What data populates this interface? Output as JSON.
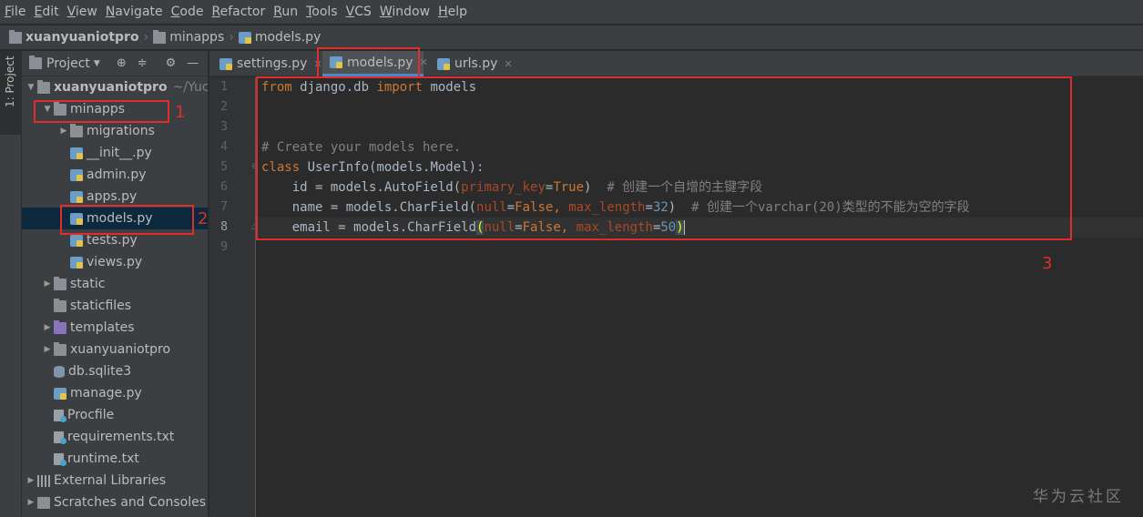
{
  "menu": {
    "items": [
      {
        "mnemonic": "F",
        "rest": "ile"
      },
      {
        "mnemonic": "E",
        "rest": "dit"
      },
      {
        "mnemonic": "V",
        "rest": "iew"
      },
      {
        "mnemonic": "N",
        "rest": "avigate"
      },
      {
        "mnemonic": "C",
        "rest": "ode"
      },
      {
        "mnemonic": "R",
        "rest": "efactor"
      },
      {
        "mnemonic": "R",
        "rest": "un"
      },
      {
        "mnemonic": "T",
        "rest": "ools"
      },
      {
        "mnemonic": "V",
        "rest": "CS"
      },
      {
        "mnemonic": "W",
        "rest": "indow"
      },
      {
        "mnemonic": "H",
        "rest": "elp"
      }
    ]
  },
  "breadcrumb": [
    "xuanyuaniotpro",
    "minapps",
    "models.py"
  ],
  "stripe": {
    "label": "1: Project"
  },
  "project_panel": {
    "title": "Project",
    "tree": [
      {
        "label": "xuanyuaniotpro",
        "path": "~/Yuchu",
        "icon": "folder-icon",
        "level": 0,
        "arrow": "down"
      },
      {
        "label": "minapps",
        "icon": "folder-icon",
        "level": 1,
        "arrow": "down"
      },
      {
        "label": "migrations",
        "icon": "folder-icon",
        "level": 2,
        "arrow": "right"
      },
      {
        "label": "__init__.py",
        "icon": "python-file-icon",
        "level": 2
      },
      {
        "label": "admin.py",
        "icon": "python-file-icon",
        "level": 2
      },
      {
        "label": "apps.py",
        "icon": "python-file-icon",
        "level": 2
      },
      {
        "label": "models.py",
        "icon": "python-file-icon",
        "level": 2,
        "selected": true
      },
      {
        "label": "tests.py",
        "icon": "python-file-icon",
        "level": 2
      },
      {
        "label": "views.py",
        "icon": "python-file-icon",
        "level": 2
      },
      {
        "label": "static",
        "icon": "folder-icon",
        "level": 1,
        "arrow": "right"
      },
      {
        "label": "staticfiles",
        "icon": "folder-icon",
        "level": 1
      },
      {
        "label": "templates",
        "icon": "template-folder-icon",
        "level": 1,
        "arrow": "right"
      },
      {
        "label": "xuanyuaniotpro",
        "icon": "folder-icon",
        "level": 1,
        "arrow": "right"
      },
      {
        "label": "db.sqlite3",
        "icon": "database-icon",
        "level": 1
      },
      {
        "label": "manage.py",
        "icon": "python-file-icon",
        "level": 1
      },
      {
        "label": "Procfile",
        "icon": "text-file-icon",
        "level": 1
      },
      {
        "label": "requirements.txt",
        "icon": "text-file-icon",
        "level": 1
      },
      {
        "label": "runtime.txt",
        "icon": "text-file-icon",
        "level": 1
      },
      {
        "label": "External Libraries",
        "icon": "libraries-icon",
        "level": 0,
        "arrow": "right"
      },
      {
        "label": "Scratches and Consoles",
        "icon": "scratches-icon",
        "level": 0,
        "arrow": "right"
      }
    ]
  },
  "tabs": [
    {
      "label": "settings.py",
      "active": false
    },
    {
      "label": "models.py",
      "active": true
    },
    {
      "label": "urls.py",
      "active": false
    }
  ],
  "editor": {
    "current_line": 8,
    "lines": [
      "from django.db import models",
      "",
      "",
      "# Create your models here.",
      "class UserInfo(models.Model):",
      "    id = models.AutoField(primary_key=True)  # 创建一个自增的主键字段",
      "    name = models.CharField(null=False, max_length=32)  # 创建一个varchar(20)类型的不能为空的字段",
      "    email = models.CharField(null=False, max_length=50)",
      ""
    ]
  },
  "annotations": [
    "1",
    "2",
    "3"
  ],
  "watermark": "华为云社区",
  "colors": {
    "annotation_red": "#e02c2c",
    "keyword": "#cc7832",
    "comment": "#808080",
    "number": "#6897bb",
    "param": "#aa4926",
    "code_default": "#a9b7c6",
    "selection": "#0d293e"
  }
}
